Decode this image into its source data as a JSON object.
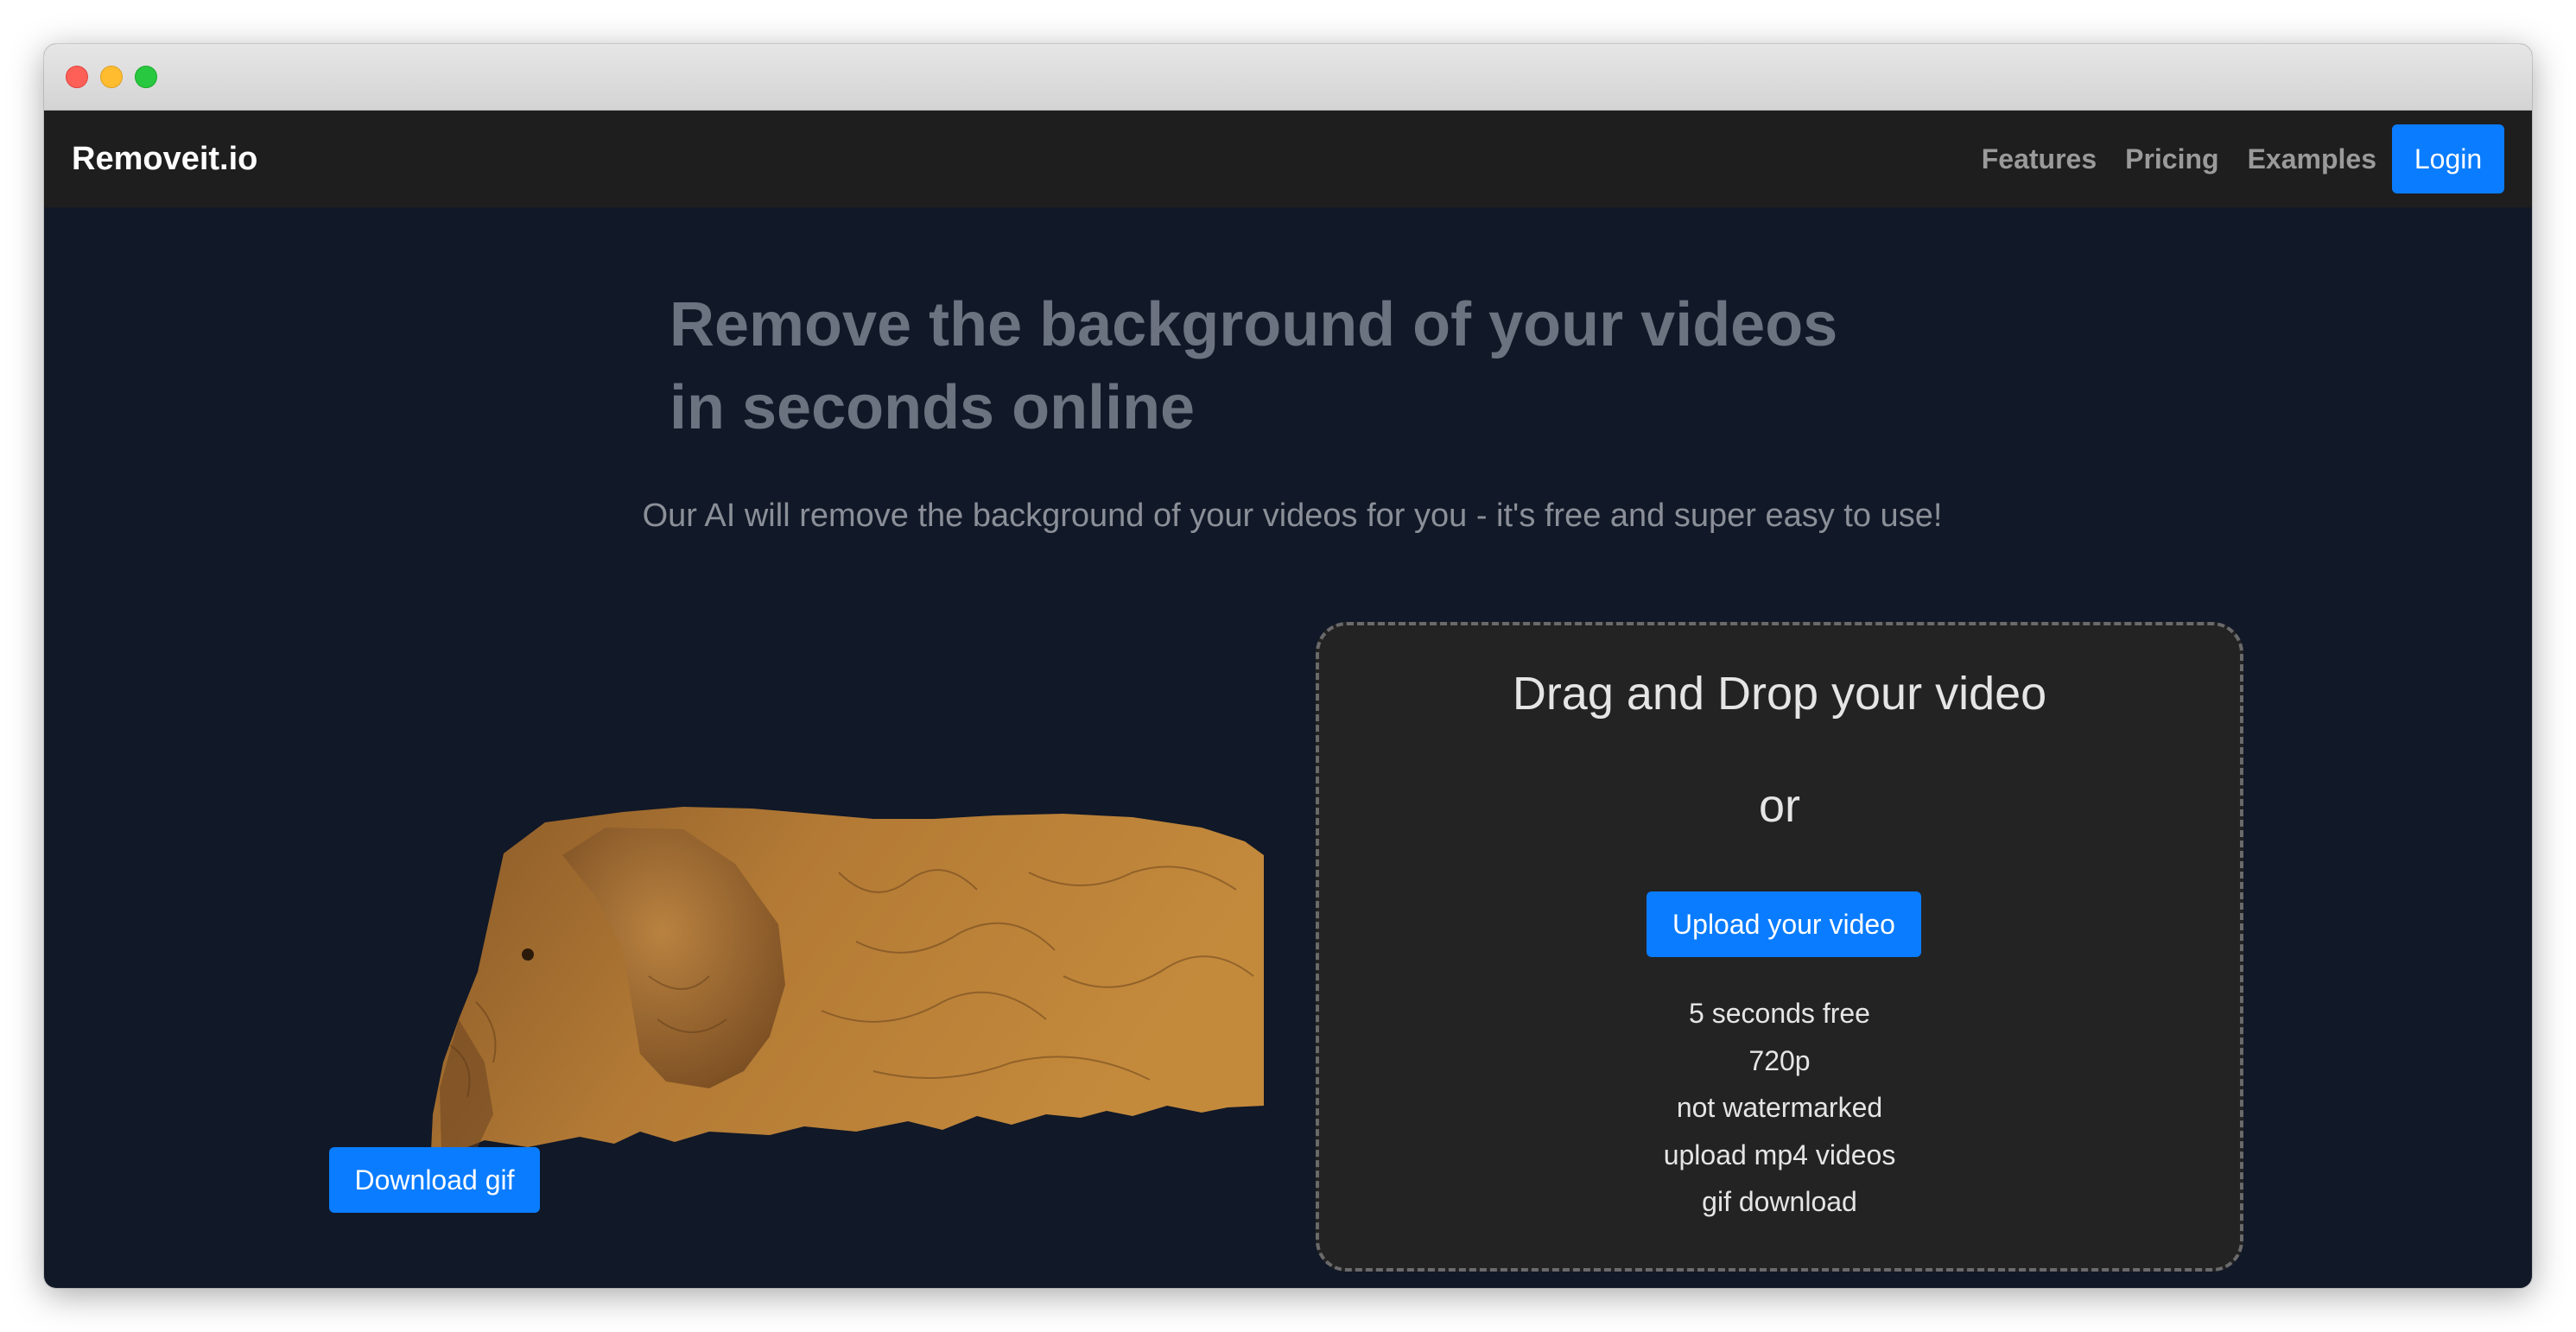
{
  "window": {
    "controls": [
      "close",
      "minimize",
      "zoom"
    ]
  },
  "navbar": {
    "brand": "Removeit.io",
    "links": [
      "Features",
      "Pricing",
      "Examples"
    ],
    "login_label": "Login"
  },
  "hero": {
    "headline_line1": "Remove the background of your videos",
    "headline_line2": "in seconds online",
    "subheadline": "Our AI will remove the background of your videos for you - it's free and super easy to use!"
  },
  "preview": {
    "image": "elephant-cutout",
    "download_label": "Download gif"
  },
  "dropzone": {
    "title": "Drag and Drop your video",
    "or_text": "or",
    "upload_label": "Upload your video",
    "features": [
      "5 seconds free",
      "720p",
      "not watermarked",
      "upload mp4 videos",
      "gif download"
    ]
  },
  "colors": {
    "accent": "#0a7cff",
    "navbar_bg": "#1e1e1e",
    "page_bg": "#111827",
    "dropzone_bg": "#232323"
  }
}
